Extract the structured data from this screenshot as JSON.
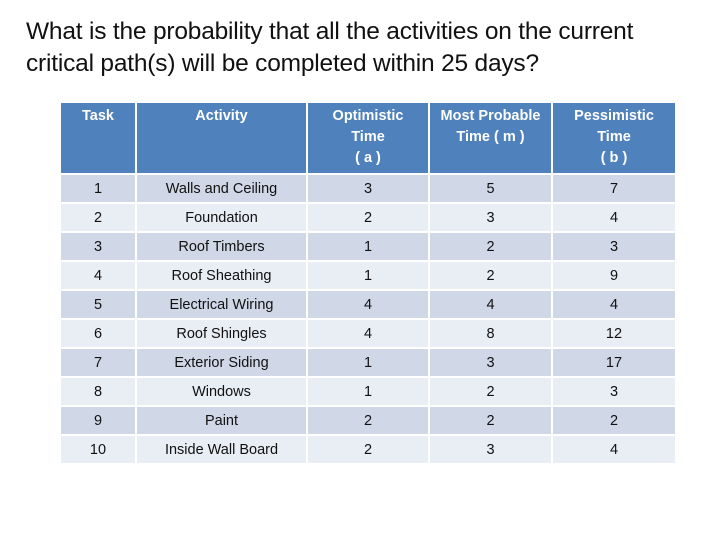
{
  "question": "What is the probability that all the activities on the current critical path(s) will be completed within 25 days?",
  "table": {
    "headers": [
      [
        "Task"
      ],
      [
        "Activity"
      ],
      [
        "Optimistic",
        "Time",
        "( a )"
      ],
      [
        "Most Probable",
        "Time ( m )"
      ],
      [
        "Pessimistic",
        "Time",
        "( b )"
      ]
    ],
    "rows": [
      [
        "1",
        "Walls and Ceiling",
        "3",
        "5",
        "7"
      ],
      [
        "2",
        "Foundation",
        "2",
        "3",
        "4"
      ],
      [
        "3",
        "Roof Timbers",
        "1",
        "2",
        "3"
      ],
      [
        "4",
        "Roof Sheathing",
        "1",
        "2",
        "9"
      ],
      [
        "5",
        "Electrical Wiring",
        "4",
        "4",
        "4"
      ],
      [
        "6",
        "Roof Shingles",
        "4",
        "8",
        "12"
      ],
      [
        "7",
        "Exterior Siding",
        "1",
        "3",
        "17"
      ],
      [
        "8",
        "Windows",
        "1",
        "2",
        "3"
      ],
      [
        "9",
        "Paint",
        "2",
        "2",
        "2"
      ],
      [
        "10",
        "Inside Wall Board",
        "2",
        "3",
        "4"
      ]
    ]
  },
  "colors": {
    "header_bg": "#4f81bd",
    "row_odd_bg": "#d0d8e8",
    "row_even_bg": "#e9edf4"
  }
}
